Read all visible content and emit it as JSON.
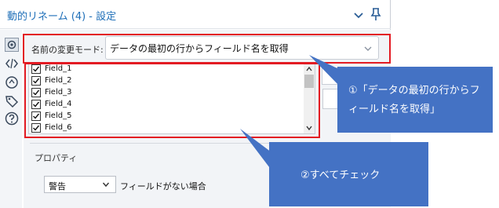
{
  "window": {
    "title": "動的リネーム (4) - 設定",
    "title_color": "#1f6fb8"
  },
  "left_toolbar": {
    "icons": [
      "gear-icon",
      "code-icon",
      "rename-icon",
      "tag-icon",
      "help-icon"
    ]
  },
  "mode": {
    "label": "名前の変更モード:",
    "selected": "データの最初の行からフィールド名を取得"
  },
  "fields": {
    "items": [
      {
        "label": "Field_1",
        "checked": true
      },
      {
        "label": "Field_2",
        "checked": true
      },
      {
        "label": "Field_3",
        "checked": true
      },
      {
        "label": "Field_4",
        "checked": true
      },
      {
        "label": "Field_5",
        "checked": true
      },
      {
        "label": "Field_6",
        "checked": true
      }
    ]
  },
  "properties": {
    "section_label": "プロパティ",
    "missing_field_action": "警告",
    "missing_field_label": "フィールドがない場合"
  },
  "callouts": {
    "one": "①「データの最初の行からフィールド名を取得」",
    "two": "②すべてチェック",
    "fill_color": "#4472c4",
    "highlight_color": "#e31b23"
  }
}
